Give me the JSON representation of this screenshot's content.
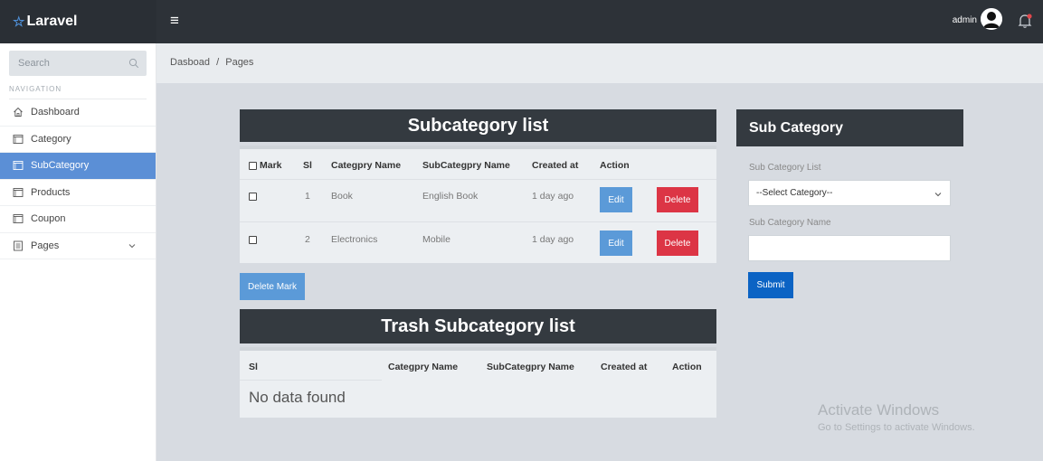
{
  "brand": {
    "icon": "star-icon",
    "name": "Laravel"
  },
  "header": {
    "menu_icon": "hamburger-icon",
    "user_name": "admin",
    "avatar_icon": "user-avatar-icon",
    "notification_icon": "bell-icon"
  },
  "sidebar": {
    "search_placeholder": "Search",
    "nav_label": "NAVIGATION",
    "items": [
      {
        "label": "Dashboard",
        "icon": "home-icon"
      },
      {
        "label": "Category",
        "icon": "window-icon"
      },
      {
        "label": "SubCategory",
        "icon": "window-icon",
        "active": true
      },
      {
        "label": "Products",
        "icon": "window-icon"
      },
      {
        "label": "Coupon",
        "icon": "window-icon"
      },
      {
        "label": "Pages",
        "icon": "document-icon"
      }
    ],
    "active_color": "#5b8fd6"
  },
  "breadcrumb": {
    "root": "Dasboad",
    "separator": "/",
    "current": "Pages"
  },
  "subcategory_list": {
    "title": "Subcategory list",
    "headers": {
      "mark": "Mark",
      "sl": "Sl",
      "category": "Categpry Name",
      "subcategory": "SubCategpry Name",
      "created": "Created at",
      "action": "Action"
    },
    "rows": [
      {
        "sl": "1",
        "category": "Book",
        "subcategory": "English Book",
        "created": "1 day ago",
        "edit": "Edit",
        "delete": "Delete"
      },
      {
        "sl": "2",
        "category": "Electronics",
        "subcategory": "Mobile",
        "created": "1 day ago",
        "edit": "Edit",
        "delete": "Delete"
      }
    ],
    "delete_mark_label": "Delete Mark"
  },
  "trash_list": {
    "title": "Trash Subcategory list",
    "headers": {
      "sl": "Sl",
      "category": "Categpry Name",
      "subcategory": "SubCategpry Name",
      "created": "Created at",
      "action": "Action"
    },
    "empty_text": "No data found"
  },
  "form": {
    "title": "Sub Category",
    "list_label": "Sub Category List",
    "select_value": "--Select Category--",
    "name_label": "Sub Category Name",
    "name_value": "",
    "submit_label": "Submit"
  },
  "watermark": {
    "title": "Activate Windows",
    "subtitle": "Go to Settings to activate Windows."
  },
  "colors": {
    "header_dark": "#343a40",
    "edit": "#5b9ad8",
    "delete": "#dc3545",
    "submit": "#0b63c4"
  }
}
